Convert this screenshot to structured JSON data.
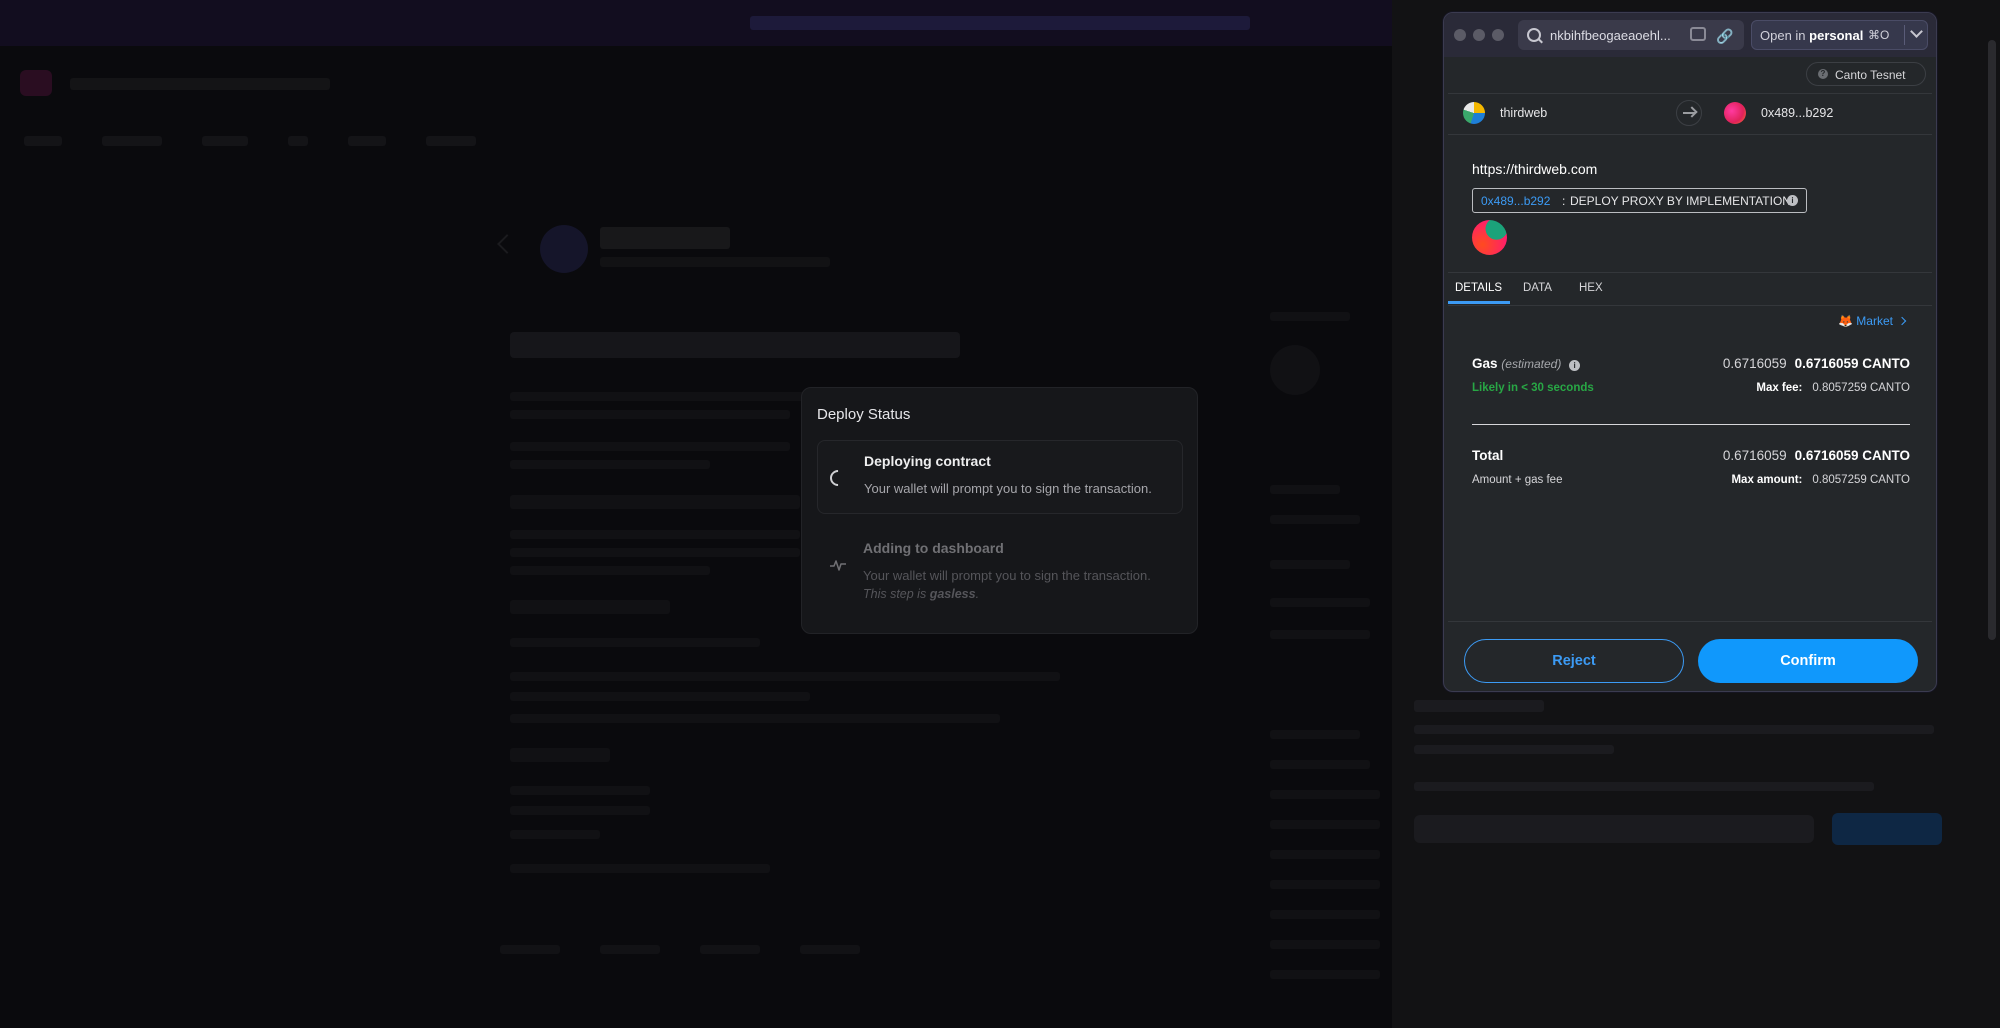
{
  "deploy_modal": {
    "title": "Deploy Status",
    "steps": [
      {
        "title": "Deploying contract",
        "description": "Your wallet will prompt you to sign the transaction.",
        "status": "in-progress"
      },
      {
        "title": "Adding to dashboard",
        "description": "Your wallet will prompt you to sign the transaction.",
        "note_prefix": "This step is ",
        "note_emphasis": "gasless",
        "note_suffix": ".",
        "status": "pending"
      }
    ]
  },
  "metamask": {
    "url_text": "nkbihfbeogaeaoehl...",
    "open_in_prefix": "Open in ",
    "open_in_profile": "personal",
    "open_in_shortcut": "⌘O",
    "network": "Canto Tesnet",
    "network_icon": "question-icon",
    "from_account": "thirdweb",
    "to_account": "0x489...b292",
    "origin": "https://thirdweb.com",
    "contract_address": "0x489...b292",
    "method_separator": ":",
    "method_name": "DEPLOY PROXY BY IMPLEMENTATION",
    "tabs": [
      {
        "label": "DETAILS",
        "active": true
      },
      {
        "label": "DATA",
        "active": false
      },
      {
        "label": "HEX",
        "active": false
      }
    ],
    "market_label": "Market",
    "gas": {
      "label": "Gas",
      "qualifier": "(estimated)",
      "value": "0.6716059",
      "value_bold": "0.6716059 CANTO",
      "timing": "Likely in < 30 seconds",
      "max_fee_label": "Max fee:",
      "max_fee_value": "0.8057259 CANTO"
    },
    "total": {
      "label": "Total",
      "value": "0.6716059",
      "value_bold": "0.6716059 CANTO",
      "sub_label": "Amount + gas fee",
      "max_amount_label": "Max amount:",
      "max_amount_value": "0.8057259 CANTO"
    },
    "reject_label": "Reject",
    "confirm_label": "Confirm"
  },
  "colors": {
    "accent_blue": "#1098fc",
    "success_green": "#28a745",
    "popup_bg": "#24272a"
  }
}
